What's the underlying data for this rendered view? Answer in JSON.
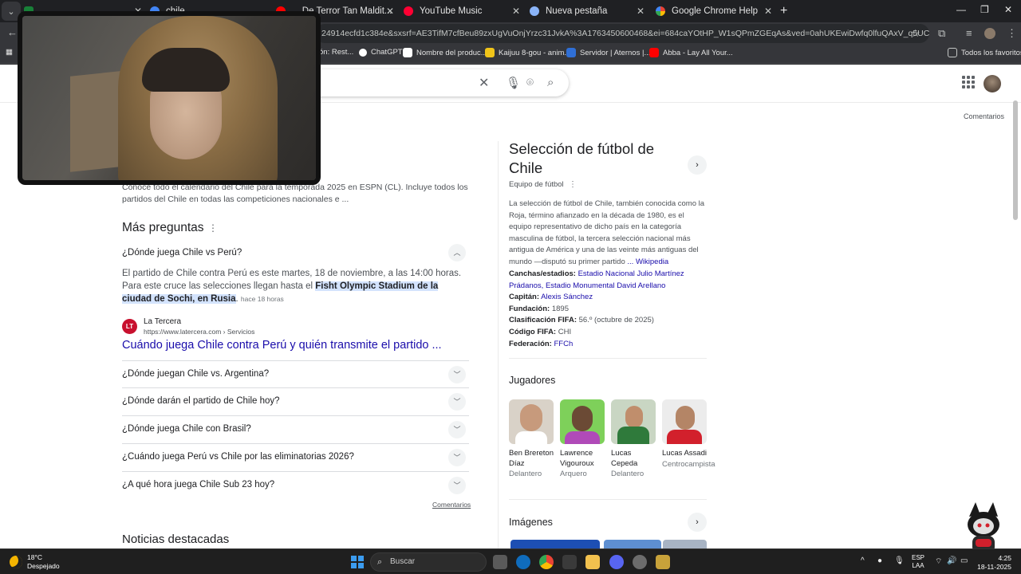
{
  "browser": {
    "tabs": [
      {
        "label": "...",
        "active": false
      },
      {
        "label": "chile...",
        "active": false
      },
      {
        "label": "... De Terror Tan Maldit...",
        "active": false
      },
      {
        "label": "YouTube Music",
        "active": false
      },
      {
        "label": "Nueva pestaña",
        "active": false
      },
      {
        "label": "Google Chrome Help",
        "active": false
      }
    ],
    "address": "24914ecfd1c384e&sxsrf=AE3TifM7cfBeu89zxUgVuOnjYrzc31JvkA%3A1763450600468&ei=684caYOtHP_W1sQPmZGEqAs&ved=0ahUKEwiDwfq0lfuQAxV_q5UCHZkIAbUQ4dUD...",
    "bookmarks": [
      {
        "label": "ón: Rest...",
        "color": "#5f6368"
      },
      {
        "label": "ChatGPT",
        "color": "#ffffff"
      },
      {
        "label": "Nombre del produc...",
        "color": "#ffffff"
      },
      {
        "label": "Kaijuu 8-gou - anim...",
        "color": "#f0c419"
      },
      {
        "label": "Servidor | Aternos |...",
        "color": "#2f6fd6"
      },
      {
        "label": "Abba - Lay All Your...",
        "color": "#ff0000"
      }
    ],
    "all_bookmarks": "Todos los favoritos"
  },
  "search": {
    "feedback": "Comentarios"
  },
  "results": {
    "snippet_text": "Conoce todo el calendario del Chile para la temporada 2025 en ESPN (CL). Incluye todos los partidos del Chile en todas las competiciones nacionales e ...",
    "paa_title": "Más preguntas",
    "expanded_question": "¿Dónde juega Chile vs Perú?",
    "answer_before": "El partido de Chile contra Perú es este martes, 18 de noviembre, a las 14:00 horas. Para este cruce las selecciones llegan hasta el ",
    "answer_highlight": "Fisht Olympic Stadium de la ciudad de Sochi, en Rusia",
    "answer_after": ".",
    "answer_age": "hace 18 horas",
    "source_logo": "LT",
    "source_name": "La Tercera",
    "source_url": "https://www.latercera.com › Servicios",
    "source_title": "Cuándo juega Chile contra Perú y quién transmite el partido ...",
    "questions": [
      "¿Dónde juegan Chile vs. Argentina?",
      "¿Dónde darán el partido de Chile hoy?",
      "¿Dónde juega Chile con Brasil?",
      "¿Cuándo juega Perú vs Chile por las eliminatorias 2026?",
      "¿A qué hora juega Chile Sub 23 hoy?"
    ],
    "feedback_small": "Comentarios",
    "news_title": "Noticias destacadas"
  },
  "knowledge_panel": {
    "title": "Selección de fútbol de Chile",
    "subtitle": "Equipo de fútbol",
    "description": "La selección de fútbol de Chile, también conocida como la Roja,  término afianzado en la década de 1980,  es el equipo representativo de dicho país en la categoría masculina de fútbol, la tercera selección nacional más antigua de América y una de las veinte más antiguas del mundo —disputó su primer partido ",
    "description_link": "... Wikipedia",
    "facts": [
      {
        "label": "Canchas/estadios:",
        "value": "Estadio Nacional Julio Martínez Prádanos, Estadio Monumental David Arellano",
        "link": true
      },
      {
        "label": "Capitán:",
        "value": "Alexis Sánchez",
        "link": true
      },
      {
        "label": "Fundación:",
        "value": "1895",
        "link": false
      },
      {
        "label": "Clasificación FIFA:",
        "value": "56.º (octubre de 2025)",
        "link": false
      },
      {
        "label": "Código FIFA:",
        "value": "CHI",
        "link": false
      },
      {
        "label": "Federación:",
        "value": "FFCh",
        "link": true
      }
    ],
    "players_title": "Jugadores",
    "players": [
      {
        "name": "Ben Brereton Díaz",
        "role": "Delantero",
        "bg": "#d9d2c8",
        "shirt": "#ffffff"
      },
      {
        "name": "Lawrence Vigouroux",
        "role": "Arquero",
        "bg": "#7ed05a",
        "shirt": "#b04ab8"
      },
      {
        "name": "Lucas Cepeda",
        "role": "Delantero",
        "bg": "#c9d6c3",
        "shirt": "#2f7a3b"
      },
      {
        "name": "Lucas Assadi",
        "role": "Centrocampista",
        "bg": "#ececec",
        "shirt": "#d2202c"
      }
    ],
    "images_title": "Imágenes"
  },
  "taskbar": {
    "temp": "18°C",
    "condition": "Despejado",
    "search_placeholder": "Buscar",
    "lang_top": "ESP",
    "lang_bottom": "LAA",
    "time": "4:25",
    "date": "18-11-2025"
  }
}
